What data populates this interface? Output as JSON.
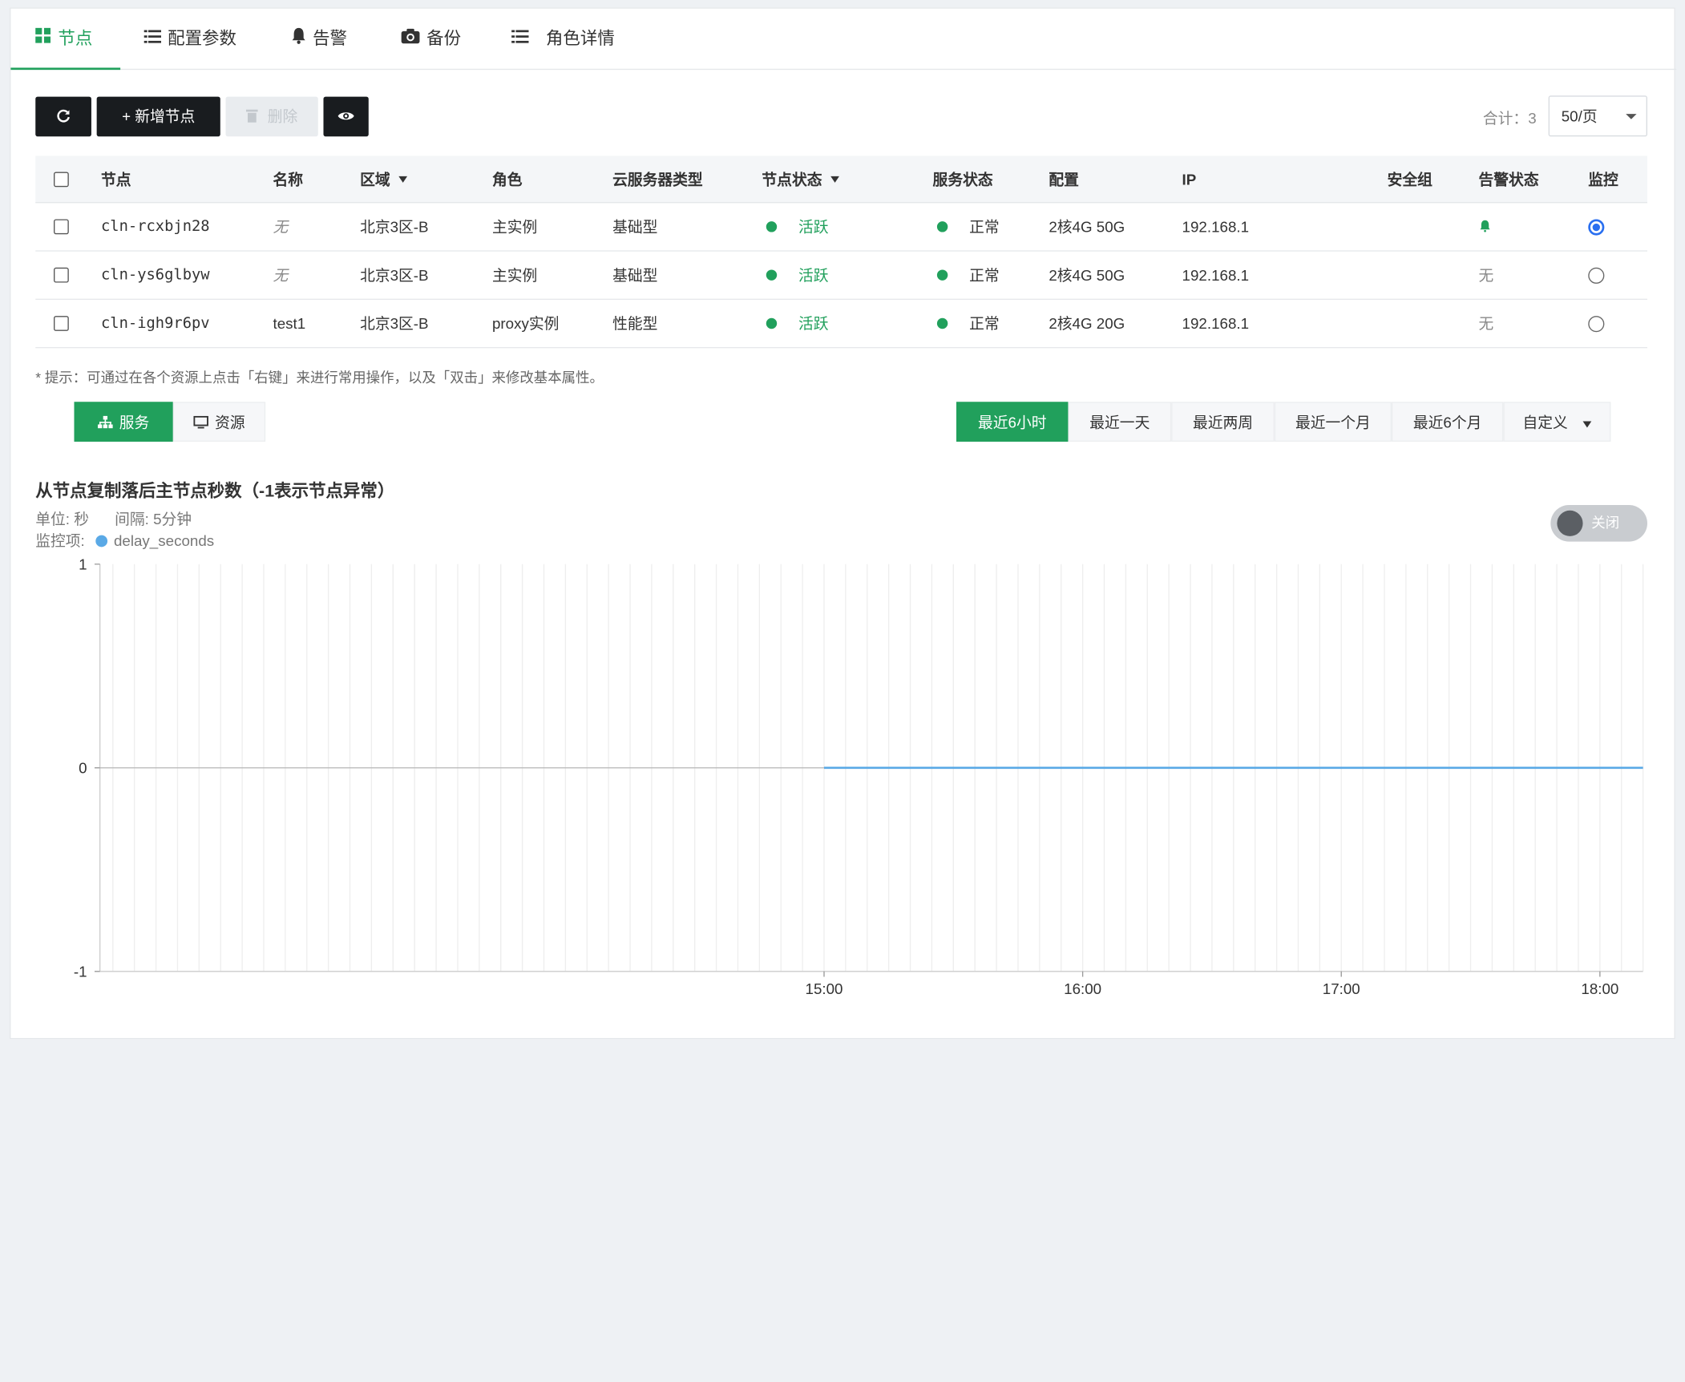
{
  "tabs": [
    {
      "label": "节点",
      "icon": "grid-icon"
    },
    {
      "label": "配置参数",
      "icon": "list-icon"
    },
    {
      "label": "告警",
      "icon": "bell-icon"
    },
    {
      "label": "备份",
      "icon": "camera-icon"
    },
    {
      "label": "角色详情",
      "icon": "list-icon"
    }
  ],
  "toolbar": {
    "refresh_icon": "refresh-icon",
    "add_label": "+ 新增节点",
    "delete_label": "删除",
    "view_icon": "eye-icon",
    "total_label": "合计：3",
    "page_size": "50/页"
  },
  "table": {
    "headers": [
      "节点",
      "名称",
      "区域",
      "角色",
      "云服务器类型",
      "节点状态",
      "服务状态",
      "配置",
      "IP",
      "安全组",
      "告警状态",
      "监控"
    ],
    "rows": [
      {
        "node": "cln-rcxbjn28",
        "name": "无",
        "region": "北京3区-B",
        "role": "主实例",
        "type": "基础型",
        "status": "活跃",
        "service": "正常",
        "config": "2核4G 50G",
        "ip": "192.168.1",
        "security": "",
        "alert": "",
        "monitor": true
      },
      {
        "node": "cln-ys6glbyw",
        "name": "无",
        "region": "北京3区-B",
        "role": "主实例",
        "type": "基础型",
        "status": "活跃",
        "service": "正常",
        "config": "2核4G 50G",
        "ip": "192.168.1",
        "security": "",
        "alert": "无",
        "monitor": false
      },
      {
        "node": "cln-igh9r6pv",
        "name": "test1",
        "region": "北京3区-B",
        "role": "proxy实例",
        "type": "性能型",
        "status": "活跃",
        "service": "正常",
        "config": "2核4G 20G",
        "ip": "192.168.1",
        "security": "",
        "alert": "无",
        "monitor": false
      }
    ]
  },
  "hint": "* 提示：可通过在各个资源上点击「右键」来进行常用操作，以及「双击」来修改基本属性。",
  "view_toggle": {
    "service": "服务",
    "resource": "资源"
  },
  "time_ranges": [
    "最近6小时",
    "最近一天",
    "最近两周",
    "最近一个月",
    "最近6个月"
  ],
  "time_custom": "自定义",
  "chart": {
    "unit_label": "单位: 秒",
    "interval_label": "间隔: 5分钟",
    "monitor_label": "监控项:",
    "switch_label": "关闭",
    "colors": {
      "series": "#5aa9e6",
      "accent": "#21a05c"
    }
  },
  "chart_data": {
    "type": "line",
    "title": "从节点复制落后主节点秒数（-1表示节点异常）",
    "x_ticks": [
      "15:00",
      "16:00",
      "17:00",
      "18:00"
    ],
    "y_ticks": [
      "1",
      "0",
      "-1"
    ],
    "ylim": [
      -1,
      1
    ],
    "xlim": [
      "12:12",
      "18:10"
    ],
    "grid": true,
    "series": [
      {
        "name": "delay_seconds",
        "x_start": "15:00",
        "x_end": "18:10",
        "value": 0
      }
    ]
  }
}
